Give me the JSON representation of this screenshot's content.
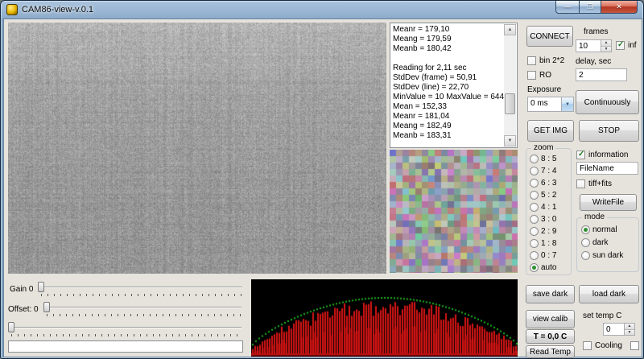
{
  "window": {
    "title": "CAM86-view-v.0.1",
    "icons": {
      "minimize": "—",
      "maximize": "❐",
      "close": "✕"
    }
  },
  "icons": {
    "up": "▲",
    "down": "▼",
    "dropdown": "▼"
  },
  "log": {
    "lines": [
      "Meanr = 179,10",
      "Meang = 179,59",
      "Meanb = 180,42",
      "",
      "Reading for 2,11 sec",
      "StdDev (frame) = 50,91",
      "StdDev (line) = 22,70",
      "MinValue = 10 MaxValue = 644",
      "Mean = 152,33",
      "Meanr = 181,04",
      "Meang = 182,49",
      "Meanb = 183,31"
    ]
  },
  "capture": {
    "connect": "CONNECT",
    "frames_label": "frames",
    "frames_value": "10",
    "inf": "inf",
    "bin": "bin 2*2",
    "ro": "RO",
    "delay_label": "delay, sec",
    "delay_value": "2",
    "exposure_label": "Exposure",
    "exposure_value": "0 ms",
    "continuously": "Continuously",
    "get_img": "GET IMG",
    "stop": "STOP"
  },
  "zoom": {
    "label": "zoom",
    "options": [
      "8 : 5",
      "7 : 4",
      "6 : 3",
      "5 : 2",
      "4 : 1",
      "3 : 0",
      "2 : 9",
      "1 : 8",
      "0 : 7",
      "auto"
    ],
    "selected": "auto"
  },
  "file": {
    "information": "information",
    "filename": "FileName",
    "tiff_fits": "tiff+fits",
    "write_file": "WriteFile"
  },
  "mode": {
    "label": "mode",
    "options": [
      "normal",
      "dark",
      "sun dark"
    ],
    "selected": "normal"
  },
  "calibration": {
    "save_dark": "save dark",
    "load_dark": "load dark",
    "view_calib": "view calib",
    "set_temp_label": "set temp C",
    "set_temp_value": "0",
    "temp_display": "T = 0,0 C",
    "read_temp": "Read Temp",
    "cooling": "Cooling"
  },
  "adjust": {
    "gain_label": "Gain 0",
    "offset_label": "Offset: 0"
  }
}
